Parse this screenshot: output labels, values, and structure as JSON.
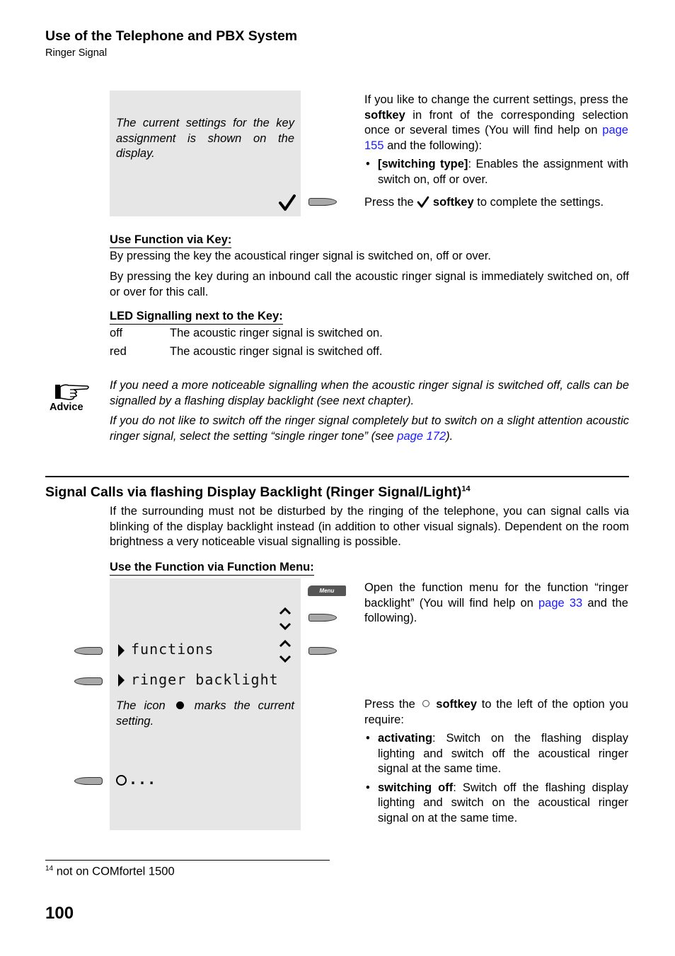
{
  "header": {
    "title": "Use of the Telephone and PBX System",
    "subtitle": "Ringer Signal"
  },
  "section1": {
    "display_note": "The current settings for the key assignment is shown on the display.",
    "instructions": {
      "p1_before_bold": "If you like to change the current settings, press the ",
      "p1_bold": "softkey",
      "p1_after_bold": " in front of the corresponding selection once or several times (You will find help on ",
      "p1_link": "page 155",
      "p1_end": " and the following):",
      "bullets": [
        {
          "bold": "[switching type]",
          "text": ": Enables the assignment with switch on, off or over."
        }
      ],
      "p2_before": "Press the ",
      "p2_bold": "softkey",
      "p2_after": " to complete the settings."
    },
    "icons": {
      "confirm": "checkmark-icon",
      "softkey": "softkey-icon"
    }
  },
  "use_function_key": {
    "heading": "Use Function via Key:",
    "p1": "By pressing the key the acoustical ringer signal is switched on, off or over.",
    "p2": "By pressing the key during an inbound call the acoustic ringer signal is immediately switched on, off or over for this call."
  },
  "led_signalling": {
    "heading": "LED Signalling next to the Key:",
    "rows": [
      {
        "state": "off",
        "desc": "The acoustic ringer signal is switched on."
      },
      {
        "state": "red",
        "desc": "The acoustic ringer signal is switched off."
      }
    ]
  },
  "advice": {
    "label": "Advice",
    "icon": "pointing-hand-icon",
    "p1": "If you need a more noticeable signalling when the acoustic ringer signal is switched off, calls can be signalled by a flashing display backlight (see next chapter).",
    "p2_before": "If you do not like to switch off the ringer signal completely but to switch on a slight attention acoustic ringer signal, select the setting “single ringer tone” (see ",
    "p2_link": "page 172",
    "p2_after": ")."
  },
  "section2": {
    "heading": "Signal Calls via flashing Display Backlight (Ringer Signal/Light)",
    "heading_footnote": "14",
    "intro": "If the surrounding must not be disturbed by the ringing of the telephone, you can signal calls via blinking of the display backlight instead (in addition to other visual signals). Dependent on the room brightness a very noticeable visual signalling is possible.",
    "subheading": "Use the Function via Function Menu:",
    "display": {
      "menu_key_label": "Menu",
      "items": [
        "functions",
        "ringer backlight"
      ],
      "note_before": "The icon ",
      "note_after": " marks the current setting.",
      "option_placeholder": "..."
    },
    "step1": {
      "before": "Open the function menu for the function “ringer backlight” (You will find help on ",
      "link": "page 33",
      "after": " and the following)."
    },
    "step2": {
      "before": "Press the ",
      "bold": "softkey",
      "after": " to the left of the option you require:",
      "bullets": [
        {
          "bold": "activating",
          "text": ": Switch on the flashing display lighting and switch off the acoustical ringer signal at the same time."
        },
        {
          "bold": "switching off",
          "text": ": Switch off the flashing display lighting and switch on the acoustical ringer signal on at the same time."
        }
      ]
    }
  },
  "footnote": {
    "number": "14",
    "text": " not on COMfortel 1500"
  },
  "page_number": "100",
  "colors": {
    "link": "#1a1aff",
    "display_bg": "#e6e6e6",
    "softkey": "#a8a8a8"
  }
}
